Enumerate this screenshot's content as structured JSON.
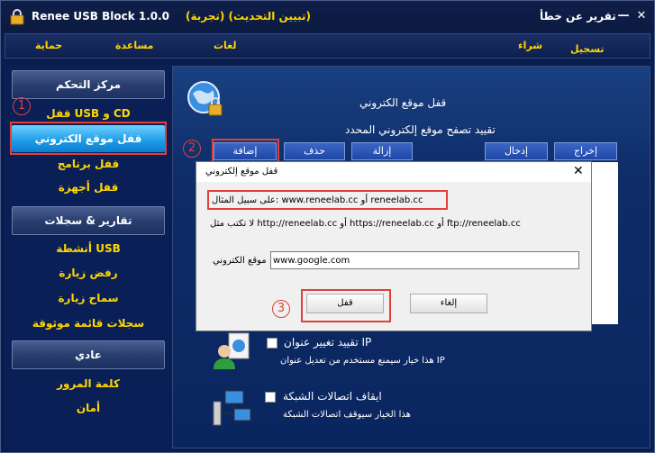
{
  "titlebar": {
    "title": "Renee USB Block 1.0.0",
    "subtitle": "(تجربة) (تبيين التحديث)",
    "report": "تقرير عن خطأ",
    "minimize": "—",
    "close": "✕"
  },
  "menu": {
    "protect": "حماية",
    "help": "مساعدة",
    "lang": "لغات",
    "buy": "شراء",
    "register": "تسجيل"
  },
  "sidebar": {
    "control_center": "مركز التحكم",
    "items": [
      {
        "label": "قفل USB و CD"
      },
      {
        "label": "قفل موقع الكتروني"
      },
      {
        "label": "قفل برنامج"
      },
      {
        "label": "قفل أجهزة"
      }
    ],
    "reports_header": "تقارير & سجلات",
    "reports": [
      {
        "label": "أنشطة USB"
      },
      {
        "label": "رفض زيارة"
      },
      {
        "label": "سماح زيارة"
      },
      {
        "label": "سجلات قائمة موثوقة"
      }
    ],
    "general_header": "عادي",
    "general": [
      {
        "label": "كلمة المرور"
      },
      {
        "label": "أمان"
      }
    ]
  },
  "main": {
    "title": "قفل موقع الكتروني",
    "description": "تقييد تصفح موقع إلكتروني المحدد",
    "buttons": {
      "add": "إضافة",
      "delete": "حذف",
      "remove": "إزالة",
      "import": "إدخال",
      "export": "إخراج"
    },
    "options": [
      {
        "title": "تقييد تغيير عنوان IP",
        "desc": "هذا خيار سيمنع مستخدم من تعديل عنوان IP"
      },
      {
        "title": "ايقاف اتصالات الشبكة",
        "desc": "هذا الخيار سيوقف اتصالات الشبكة"
      }
    ]
  },
  "dialog": {
    "title": "قفل موقع إلكتروني",
    "close": "✕",
    "example": "على سبيل المثال: www.reneelab.cc أو reneelab.cc",
    "not_type": "لا تكتب مثل http://reneelab.cc أو https://reneelab.cc أو ftp://reneelab.cc",
    "website_label": "موقع الكتروني",
    "website_value": "www.google.com",
    "lock_button": "قفل",
    "cancel_button": "إلغاء"
  },
  "annotations": {
    "n1": "1",
    "n2": "2",
    "n3": "3"
  },
  "colors": {
    "accent": "#ffd700",
    "highlight": "#e0403a",
    "active": "#1b9ae6"
  }
}
